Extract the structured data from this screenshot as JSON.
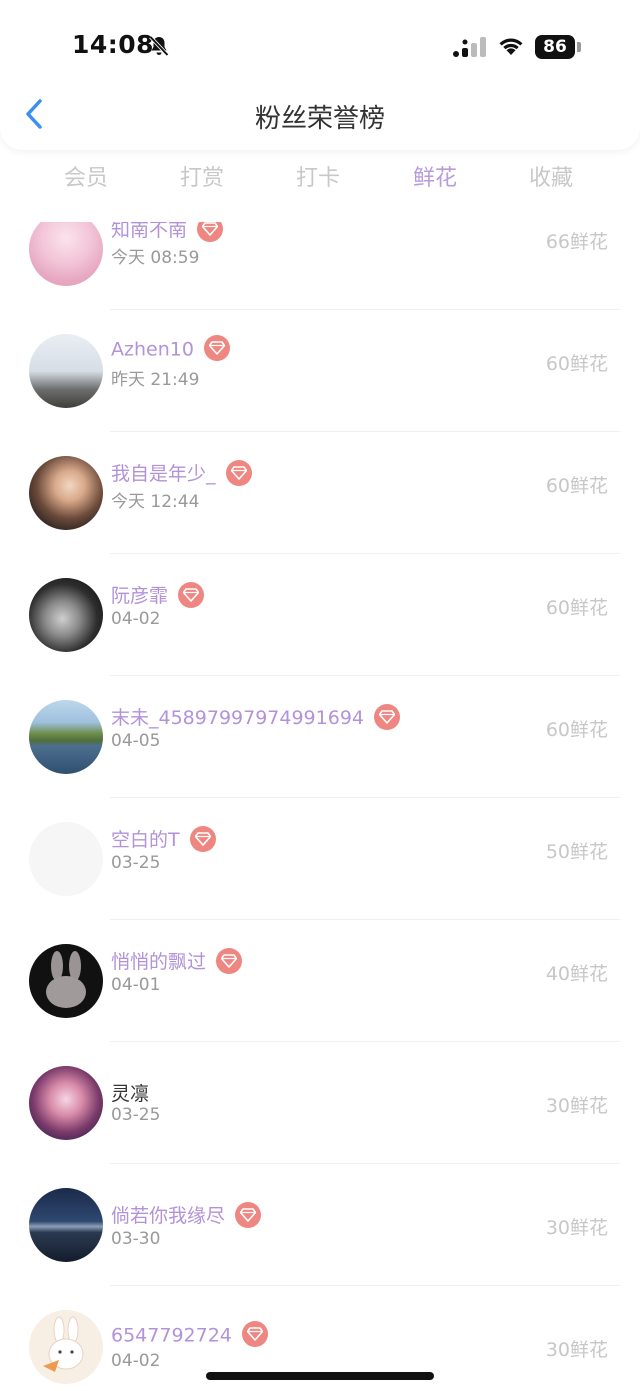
{
  "status": {
    "time": "14:08",
    "battery": "86"
  },
  "header": {
    "title": "粉丝荣誉榜"
  },
  "tabs": [
    {
      "label": "会员"
    },
    {
      "label": "打赏"
    },
    {
      "label": "打卡"
    },
    {
      "label": "鲜花",
      "active": true
    },
    {
      "label": "收藏"
    }
  ],
  "fans": [
    {
      "name": "知南不南",
      "time": "今天 08:59",
      "amount": "66鲜花",
      "vip": true,
      "avatar": "pink-anime-girl"
    },
    {
      "name": "Azhen10",
      "time": "昨天 21:49",
      "amount": "60鲜花",
      "vip": true,
      "avatar": "misty-sky-tower"
    },
    {
      "name": "我自是年少_",
      "time": "今天 12:44",
      "amount": "60鲜花",
      "vip": true,
      "avatar": "young-man"
    },
    {
      "name": "阮彦霏",
      "time": "04-02",
      "amount": "60鲜花",
      "vip": true,
      "avatar": "dark-portrait"
    },
    {
      "name": "末未_45897997974991694",
      "time": "04-05",
      "amount": "60鲜花",
      "vip": true,
      "avatar": "island-sea"
    },
    {
      "name": "空白的T",
      "time": "03-25",
      "amount": "50鲜花",
      "vip": true,
      "avatar": "blank"
    },
    {
      "name": "悄悄的飘过",
      "time": "04-01",
      "amount": "40鲜花",
      "vip": true,
      "avatar": "bunny-dark"
    },
    {
      "name": "灵凛",
      "time": "03-25",
      "amount": "30鲜花",
      "vip": false,
      "avatar": "anime-colorful"
    },
    {
      "name": "倘若你我缘尽",
      "time": "03-30",
      "amount": "30鲜花",
      "vip": true,
      "avatar": "night-sky"
    },
    {
      "name": "6547792724",
      "time": "04-02",
      "amount": "30鲜花",
      "vip": true,
      "avatar": "bunny-carrot"
    }
  ],
  "colors": {
    "accent": "#b99bd9",
    "vip_badge": "#ee8782",
    "back": "#3b8ff0"
  }
}
